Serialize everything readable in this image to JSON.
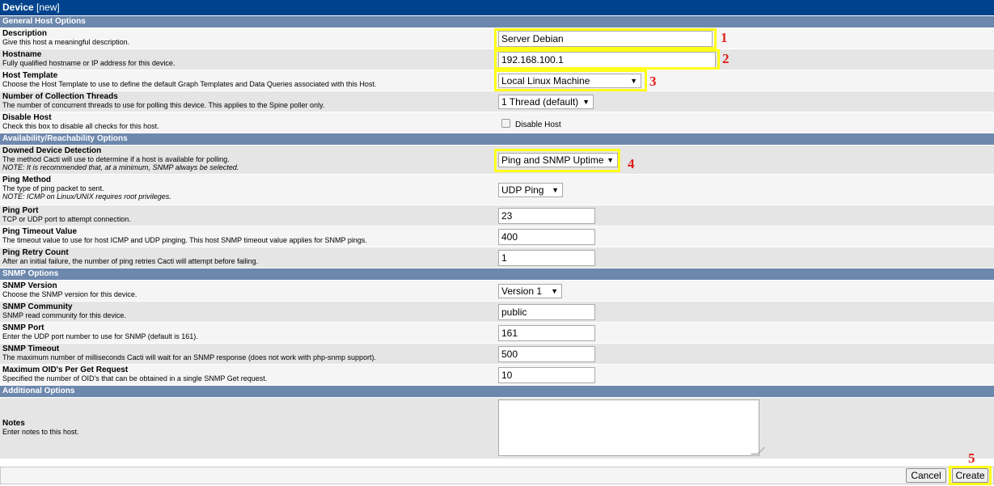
{
  "window": {
    "title": "Device",
    "subtitle": "[new]"
  },
  "sections": {
    "general": "General Host Options",
    "availability": "Availability/Reachability Options",
    "snmp": "SNMP Options",
    "additional": "Additional Options"
  },
  "fields": {
    "description": {
      "label": "Description",
      "desc": "Give this host a meaningful description.",
      "value": "Server Debian"
    },
    "hostname": {
      "label": "Hostname",
      "desc": "Fully qualified hostname or IP address for this device.",
      "value": "192.168.100.1"
    },
    "host_template": {
      "label": "Host Template",
      "desc": "Choose the Host Template to use to define the default Graph Templates and Data Queries associated with this Host.",
      "value": "Local Linux Machine"
    },
    "threads": {
      "label": "Number of Collection Threads",
      "desc": "The number of concurrent threads to use for polling this device. This applies to the Spine poller only.",
      "value": "1 Thread (default)"
    },
    "disable_host": {
      "label": "Disable Host",
      "desc": "Check this box to disable all checks for this host.",
      "checkbox_label": "Disable Host",
      "checked": false
    },
    "downed_detection": {
      "label": "Downed Device Detection",
      "desc": "The method Cacti will use to determine if a host is available for polling.",
      "note": "NOTE: It is recommended that, at a minimum, SNMP always be selected.",
      "value": "Ping and SNMP Uptime"
    },
    "ping_method": {
      "label": "Ping Method",
      "desc": "The type of ping packet to sent.",
      "note": "NOTE: ICMP on Linux/UNIX requires root privileges.",
      "value": "UDP Ping"
    },
    "ping_port": {
      "label": "Ping Port",
      "desc": "TCP or UDP port to attempt connection.",
      "value": "23"
    },
    "ping_timeout": {
      "label": "Ping Timeout Value",
      "desc": "The timeout value to use for host ICMP and UDP pinging. This host SNMP timeout value applies for SNMP pings.",
      "value": "400"
    },
    "ping_retry": {
      "label": "Ping Retry Count",
      "desc": "After an initial failure, the number of ping retries Cacti will attempt before failing.",
      "value": "1"
    },
    "snmp_version": {
      "label": "SNMP Version",
      "desc": "Choose the SNMP version for this device.",
      "value": "Version 1"
    },
    "snmp_community": {
      "label": "SNMP Community",
      "desc": "SNMP read community for this device.",
      "value": "public"
    },
    "snmp_port": {
      "label": "SNMP Port",
      "desc": "Enter the UDP port number to use for SNMP (default is 161).",
      "value": "161"
    },
    "snmp_timeout": {
      "label": "SNMP Timeout",
      "desc": "The maximum number of milliseconds Cacti will wait for an SNMP response (does not work with php-snmp support).",
      "value": "500"
    },
    "max_oids": {
      "label": "Maximum OID's Per Get Request",
      "desc": "Specified the number of OID's that can be obtained in a single SNMP Get request.",
      "value": "10"
    },
    "notes": {
      "label": "Notes",
      "desc": "Enter notes to this host.",
      "value": ""
    }
  },
  "buttons": {
    "cancel": "Cancel",
    "create": "Create"
  },
  "annotations": [
    "1",
    "2",
    "3",
    "4",
    "5"
  ],
  "colors": {
    "title_bar": "#00438c",
    "section_header": "#6d88ad",
    "highlight": "#ffff1a",
    "annotation": "#e1201a"
  }
}
